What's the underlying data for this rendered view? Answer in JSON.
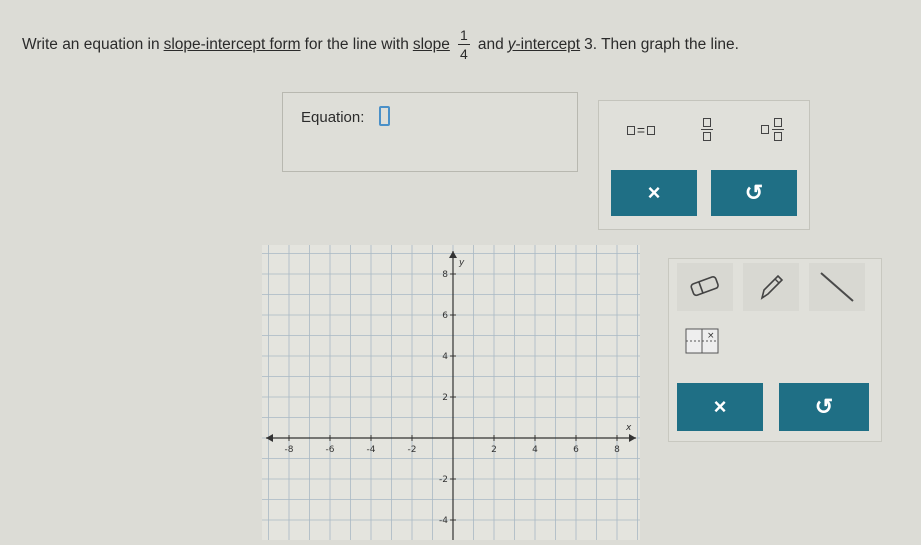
{
  "problem": {
    "part1": "Write an equation in",
    "link1": "slope-intercept form",
    "part2": "for the line with",
    "link2": "slope",
    "slope_num": "1",
    "slope_den": "4",
    "part3": "and",
    "y_var": "y",
    "link3": "-intercept",
    "intercept_value": "3",
    "part4": ". Then graph the line."
  },
  "equation": {
    "label": "Equation:"
  },
  "equation_tools": {
    "clear_symbol": "×",
    "undo_symbol": "↺",
    "equals_symbol": "="
  },
  "graph": {
    "y_axis_label": "y",
    "x_axis_label": "x",
    "y_ticks": [
      "8",
      "6",
      "4",
      "2",
      "-2",
      "-4"
    ],
    "x_ticks": [
      "-8",
      "-6",
      "-4",
      "-2",
      "2",
      "4",
      "6",
      "8"
    ],
    "range": {
      "xmin": -9,
      "xmax": 9,
      "ymin": -5,
      "ymax": 9
    }
  },
  "graph_tools": {
    "clear_symbol": "×",
    "undo_symbol": "↺"
  }
}
